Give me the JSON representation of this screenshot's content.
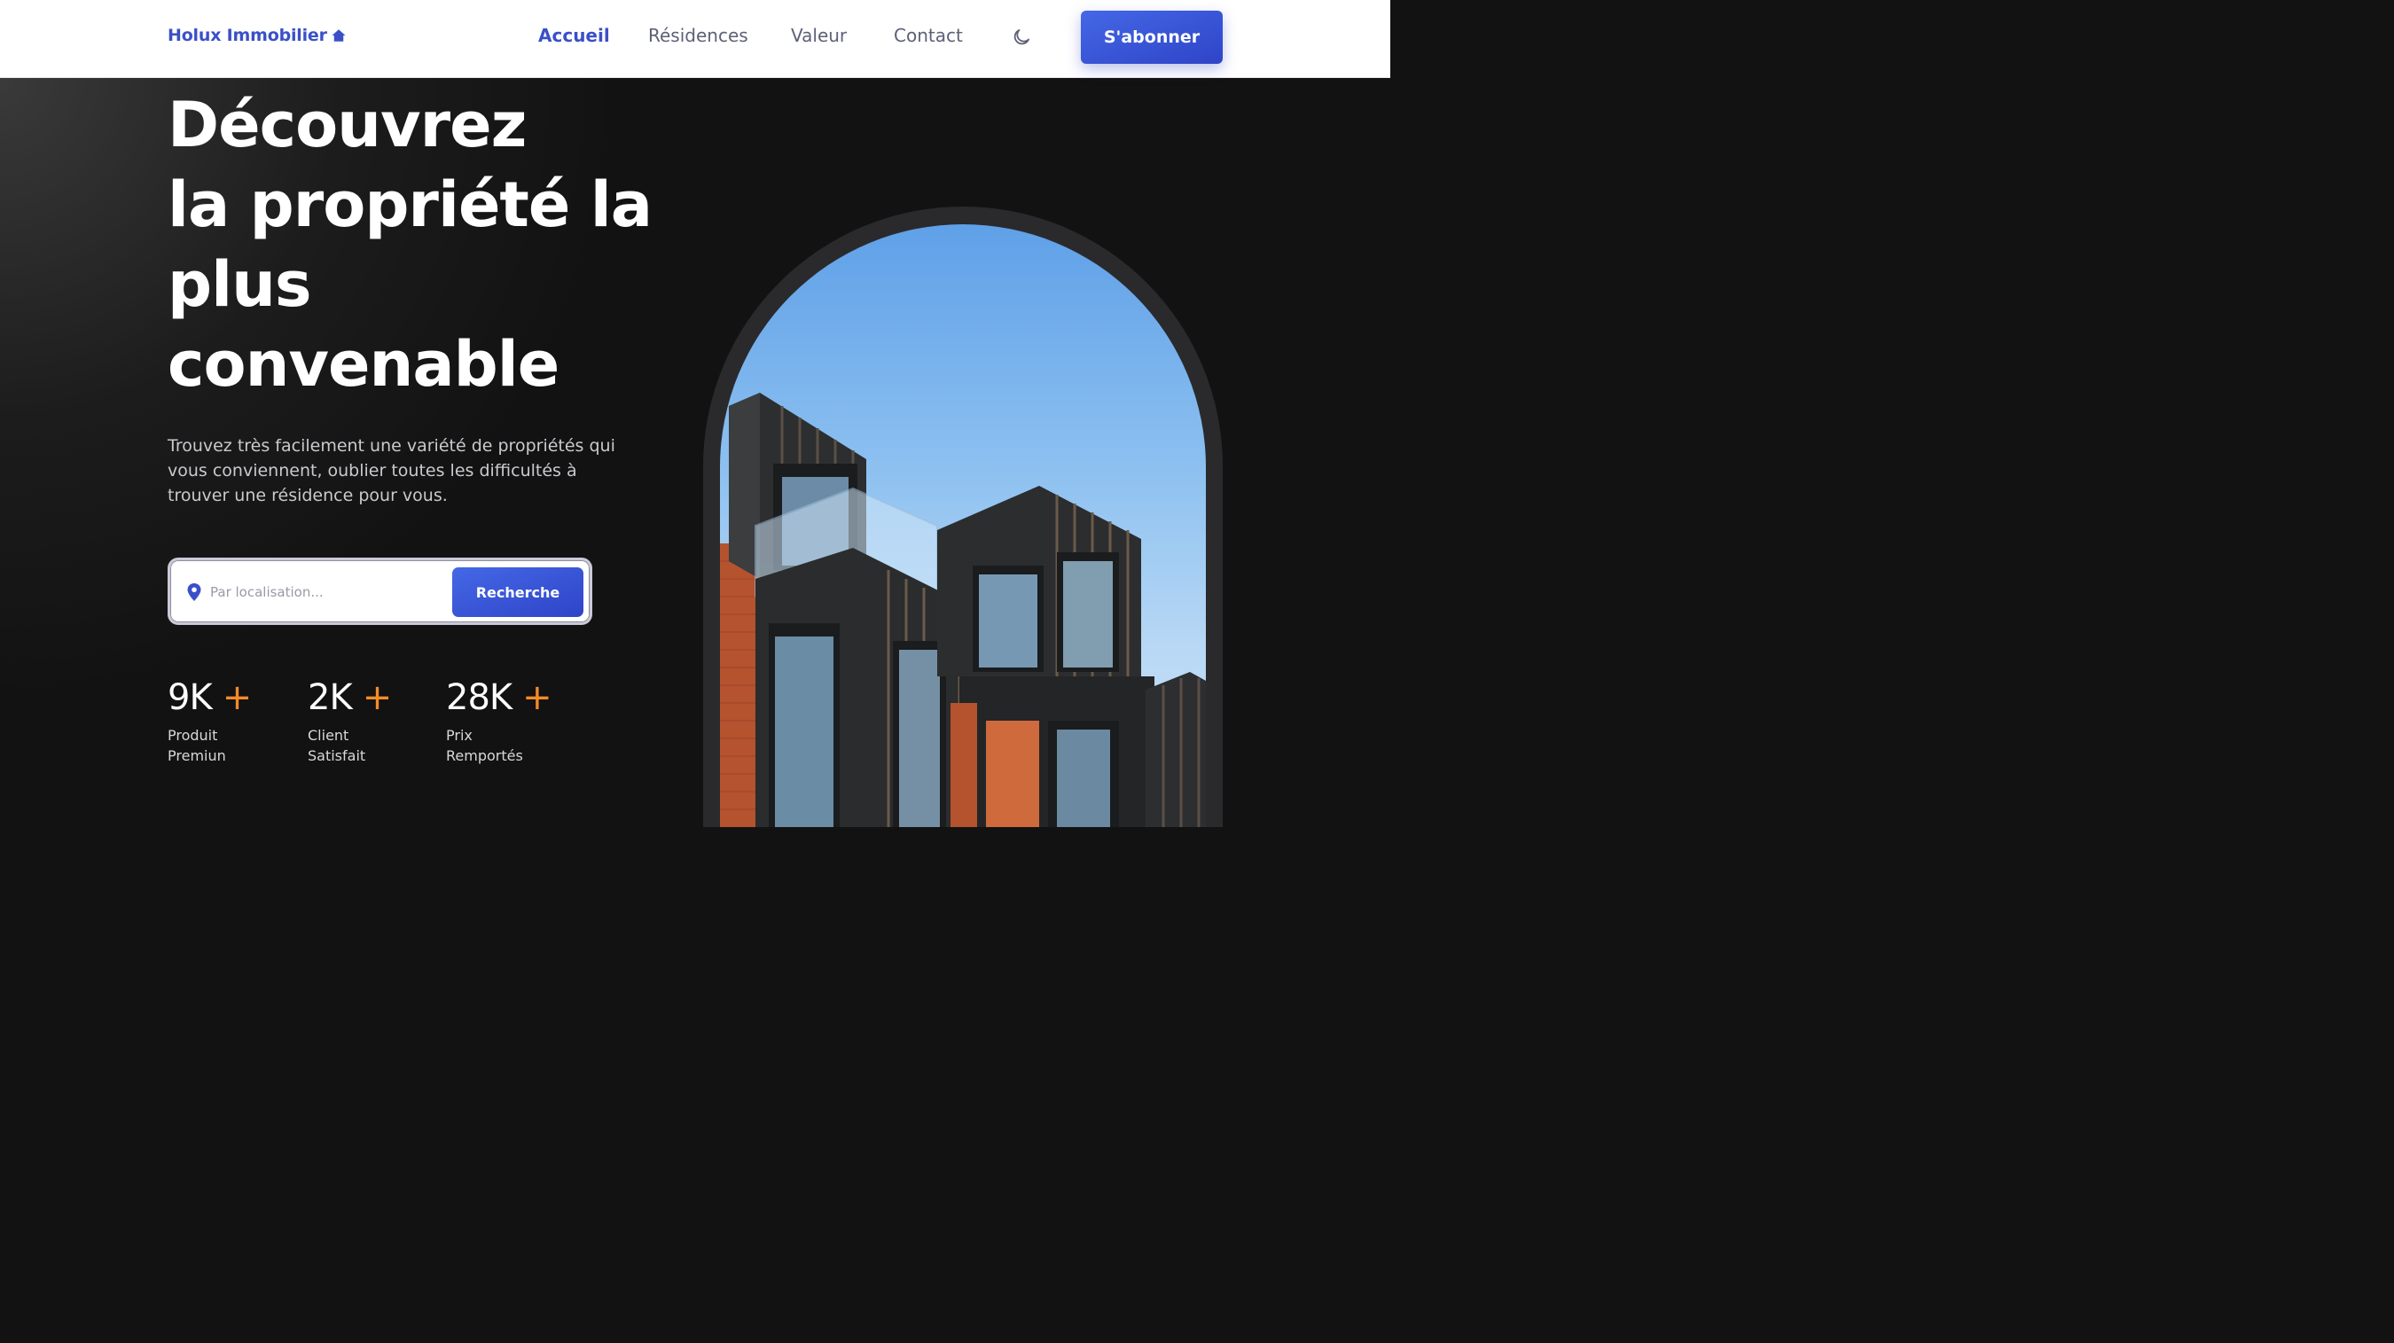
{
  "header": {
    "logo_text": "Holux Immobilier",
    "nav": [
      "Accueil",
      "Résidences",
      "Valeur",
      "Contact"
    ],
    "active_nav": "Accueil",
    "subscribe_label": "S'abonner"
  },
  "hero": {
    "title_lines": [
      "Découvrez",
      "la propriété la",
      "plus",
      "convenable"
    ],
    "description": "Trouvez très facilement une variété de propriétés qui vous conviennent, oublier toutes les difficultés à trouver une résidence pour vous.",
    "search": {
      "placeholder": "Par localisation...",
      "value": "",
      "button_label": "Recherche"
    },
    "stats": [
      {
        "value": "9K",
        "plus": "+",
        "label_line1": "Produit",
        "label_line2": "Premiun"
      },
      {
        "value": "2K",
        "plus": "+",
        "label_line1": "Client",
        "label_line2": "Satisfait"
      },
      {
        "value": "28K",
        "plus": "+",
        "label_line1": "Prix",
        "label_line2": "Remportés"
      }
    ]
  },
  "colors": {
    "accent": "#3b50c8",
    "plus": "#f48b2a",
    "background": "#121212"
  },
  "icons": {
    "logo": "home-icon",
    "theme_toggle": "moon-icon",
    "search_field": "location-pin-icon"
  }
}
